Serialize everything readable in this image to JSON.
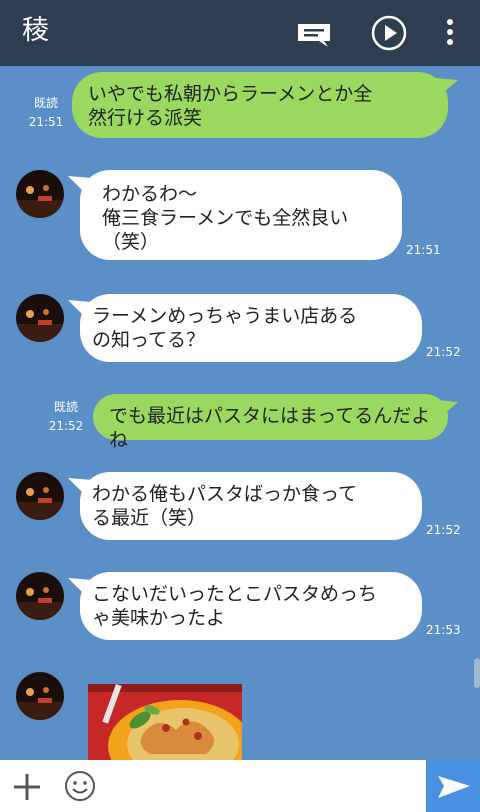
{
  "header": {
    "title": "稜",
    "memo_icon": "note-icon",
    "play_icon": "play-circle-icon",
    "more_icon": "more-vert-icon"
  },
  "colors": {
    "header_bg": "#2c3e50",
    "chat_bg": "#5b8fc7",
    "outgoing_bubble": "#9bd85f",
    "incoming_bubble": "#ffffff",
    "send_button": "#4a90e2"
  },
  "messages": [
    {
      "direction": "out",
      "lines": [
        "いやでも私朝からラーメンとか全",
        "然行ける派笑"
      ],
      "read": "既読",
      "time": "21:51"
    },
    {
      "direction": "in",
      "lines": [
        "わかるわ〜",
        "俺三食ラーメンでも全然良い（笑）"
      ],
      "time": "21:51"
    },
    {
      "direction": "in",
      "lines": [
        "ラーメンめっちゃうまい店ある",
        "の知ってる？"
      ],
      "time": "21:52"
    },
    {
      "direction": "out",
      "lines": [
        "でも最近はパスタにはまってるんだよね"
      ],
      "read": "既読",
      "time": "21:52"
    },
    {
      "direction": "in",
      "lines": [
        "わかる俺もパスタばっか食って",
        "る最近（笑）"
      ],
      "time": "21:52"
    },
    {
      "direction": "in",
      "lines": [
        "こないだいったとこパスタめっち",
        "ゃ美味かったよ"
      ],
      "time": "21:53"
    },
    {
      "direction": "in",
      "type": "image",
      "image_subject": "pasta-photo"
    }
  ],
  "footer": {
    "add_icon": "plus-icon",
    "emoji_icon": "smiley-icon",
    "input_placeholder": "",
    "input_value": "",
    "send_icon": "send-icon"
  }
}
